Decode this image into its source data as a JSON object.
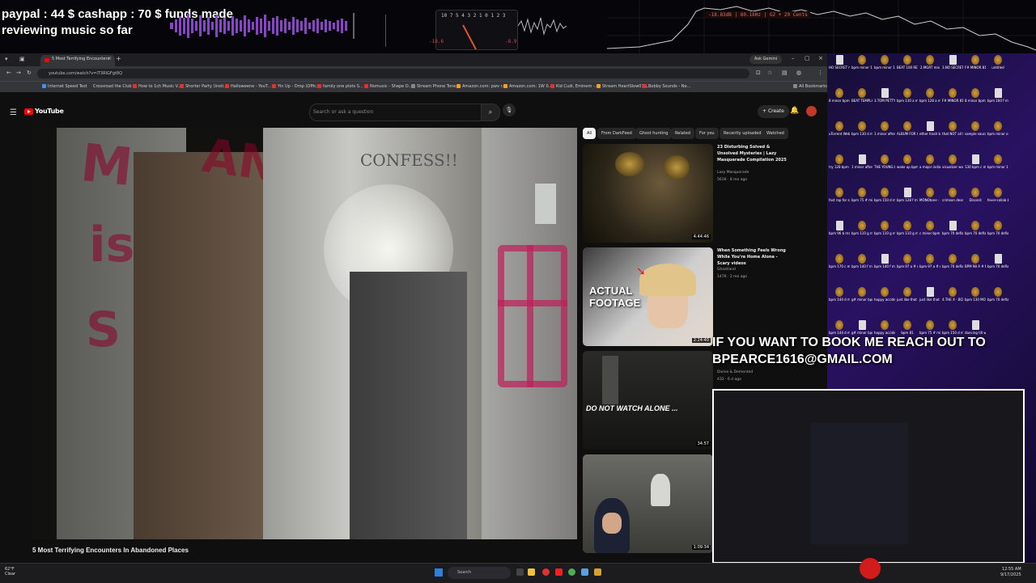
{
  "overlay": {
    "donation_line1": "paypal : 44 $  cashapp : 70 $ funds made",
    "donation_line2": "reviewing music so far",
    "vu_scale": "10 7 5 4 3 2 1 0 1 2 3",
    "vu_left": "-18.6",
    "vu_right": "-8.9",
    "spectrum_readout": "-18.83dB | 80.1kHz | G2 + 29 Cents",
    "book_line1": "IF YOU WANT TO BOOK ME REACH OUT TO",
    "book_line2": "BPEARCE1616@GMAIL.COM"
  },
  "browser": {
    "tab_title": "5 Most Terrifying Encounters",
    "ask_gemini": "Ask Gemini",
    "url": "youtube.com/watch?v=IT3RIGFgt8Q",
    "bookmarks": [
      "Internet Speed Test",
      "Crossroad the Club",
      "How to 1ch Music V...",
      "Shorter Party (Insti...",
      "Halloweene - YouT...",
      "Yin Up - Drop (Offic...",
      "family one plots S...",
      "Nomusic - Shape O...",
      "Stream Phone Tone...",
      "Amazon.com: pwv r...",
      "Amazon.com: 1W 0...",
      "Kid Cudi, Eminem -...",
      "Stream HeartSlow01 L...",
      "Bobby Sounds - Ne...",
      "All Bookmarks"
    ]
  },
  "youtube": {
    "logo_text": "YouTube",
    "search_placeholder": "Search or ask a question",
    "create_label": "Create",
    "video_title": "5 Most Terrifying Encounters In Abandoned Places",
    "graffiti_confess": "CONFESS!!",
    "chips": [
      "All",
      "From DarkFeed",
      "Ghost hunting",
      "Related",
      "For you",
      "Recently uploaded",
      "Watched"
    ],
    "recommendations": [
      {
        "title": "23 Disturbing Solved & Unsolved Mysteries | Lazy Masquerade Compilation 2025",
        "channel": "Lazy Masquerade",
        "meta": "561K · 8 mo ago",
        "duration": "4:44:46",
        "thumb_text": ""
      },
      {
        "title": "When Something Feels Wrong While You're Home Alone - Scary videos",
        "channel": "Ghostland",
        "meta": "147K · 2 mo ago",
        "duration": "2:24:40",
        "thumb_text": "ACTUAL FOOTAGE"
      },
      {
        "title": "",
        "channel": "Divine & Demented",
        "meta": "432 · 6 d ago",
        "duration": "34:57",
        "thumb_text": "DO NOT WATCH ALONE ..."
      },
      {
        "title": "",
        "channel": "",
        "meta": "",
        "duration": "1:09:34",
        "thumb_text": ""
      }
    ]
  },
  "desktop_icons": [
    "HO SECRET mix",
    "bpm minor 154",
    "bpm minor 154",
    "BEAT 100 RETTY",
    "2.MGRT mix",
    "3.NO SECRET mix",
    "F# MINOR 81 TUPAC",
    "untitled",
    "8 minor bpm 138",
    "BEAT TEMPLATE",
    "3.TOM PETTY",
    "bpm 130 a minor",
    "bpm 128 a minor",
    "F# MINOR 81 TUPAC",
    "8 minor bpm 96 monday",
    "bpm 160 f minor 5a",
    "uTorrent Web",
    "bpm 130 d minor 5m",
    "1 minor after party bpm",
    "ALBUM FOR OCTOBER",
    "ether trash b minor 115",
    "that NOT all folks bpm",
    "sample sauce - Part_1",
    "bpm minor one 128",
    "try 128 bpm 115 caffeine",
    "1 minor after party bpm",
    "THE YOUNG LAD BPM 1",
    "wake up bpm 144",
    "a major indiaster bp",
    "visualizer wack",
    "130 bpm c minor live",
    "bpm minor 114 bpm 2",
    "fast rap for sam",
    "bpm 75 # minor",
    "bpm 150 d minor bar",
    "bpm 128 f minor wh",
    "MONOtone - final mix",
    "crimson desert part 1",
    "Discord",
    "fever-collab bpm 82",
    "bpm 96 b major smo",
    "bpm 110 g minor",
    "bpm 110 g minor",
    "bpm 110 g minor",
    "c minor bpm 144 sad",
    "bpm 70 defiance",
    "bpm 70 defiance",
    "bpm 70 defiance",
    "bpm 170 c minor the",
    "bpm 140 f minor hors",
    "bpm 140 f minor left",
    "bpm 97 a # minor left",
    "bpm 97 a # minor left",
    "bpm 70 defiance",
    "BPM 98 A # MINOR U",
    "bpm 70 defiance",
    "bpm 144 d major mo",
    "g# minor bpm 144",
    "happy accident",
    "just like that intro",
    "just like that intro",
    "4.THE X - BOX",
    "bpm 130 MONOto",
    "bpm 70 defiance",
    "bpm 144 d major mo",
    "g# minor bpm 144",
    "happy accident",
    "bpm 81",
    "bpm 75 # minor",
    "bpm 150 d major",
    "dancing till we are dea"
  ],
  "taskbar": {
    "weather_temp": "62°F",
    "weather_desc": "Clear",
    "search_label": "Search",
    "clock_time": "12:55 AM",
    "clock_date": "9/17/2025"
  }
}
